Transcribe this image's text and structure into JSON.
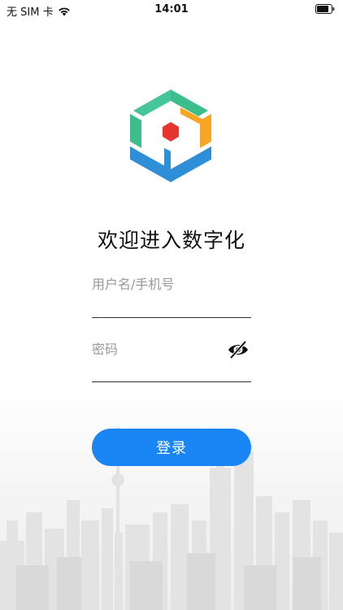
{
  "status_bar": {
    "carrier": "无 SIM 卡",
    "time": "14:01",
    "wifi_icon": "wifi-icon",
    "battery_icon": "battery-icon"
  },
  "logo_icon": "cube-logo-icon",
  "colors": {
    "accent": "#1a86f5",
    "logo_green": "#3dbd8c",
    "logo_orange": "#f6a623",
    "logo_blue": "#2f8ed8",
    "logo_red": "#e6362f"
  },
  "login": {
    "title": "欢迎进入数字化",
    "username_placeholder": "用户名/手机号",
    "username_value": "",
    "password_placeholder": "密码",
    "password_value": "",
    "password_toggle_icon": "eye-off-icon",
    "submit_label": "登录"
  },
  "background_icon": "city-skyline-image"
}
